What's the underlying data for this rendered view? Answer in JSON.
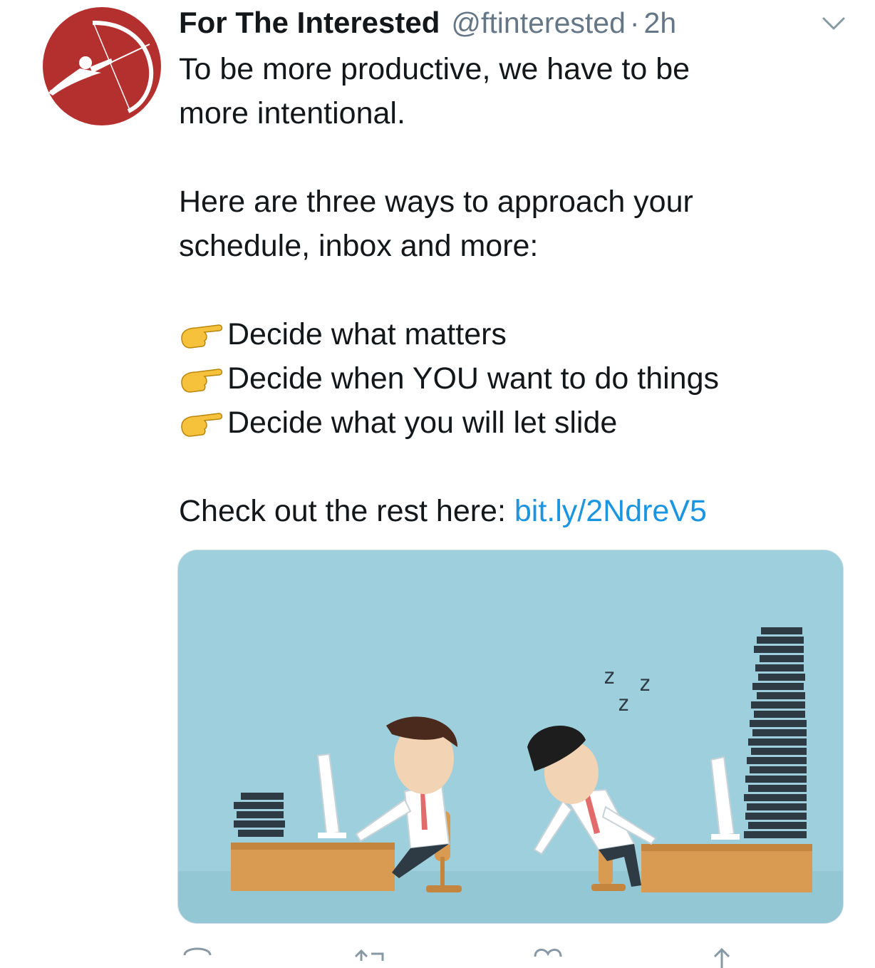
{
  "tweet": {
    "author_name": "For The Interested",
    "handle": "@ftinterested",
    "separator": "·",
    "time": "2h",
    "line1": "To be more productive, we have to be",
    "line2": "more intentional.",
    "line3": "Here are three ways to approach your",
    "line4": "schedule, inbox and more:",
    "bullets": [
      "Decide what matters",
      "Decide when YOU want to do things",
      "Decide what you will let slide"
    ],
    "cta_text": "Check out the rest here: ",
    "link": "bit.ly/2NdreV5",
    "media_text": [
      "z",
      "z",
      "z"
    ]
  },
  "colors": {
    "brand_red": "#b4302f",
    "link_blue": "#1b95e0",
    "muted": "#657786",
    "image_sky": "#9ecfdc"
  },
  "icons": {
    "avatar": "archer-logo",
    "menu": "chevron-down-icon",
    "bullet": "backhand-index-pointing-right-emoji",
    "reply": "reply-icon",
    "retweet": "retweet-icon",
    "like": "heart-icon",
    "share": "share-icon"
  }
}
